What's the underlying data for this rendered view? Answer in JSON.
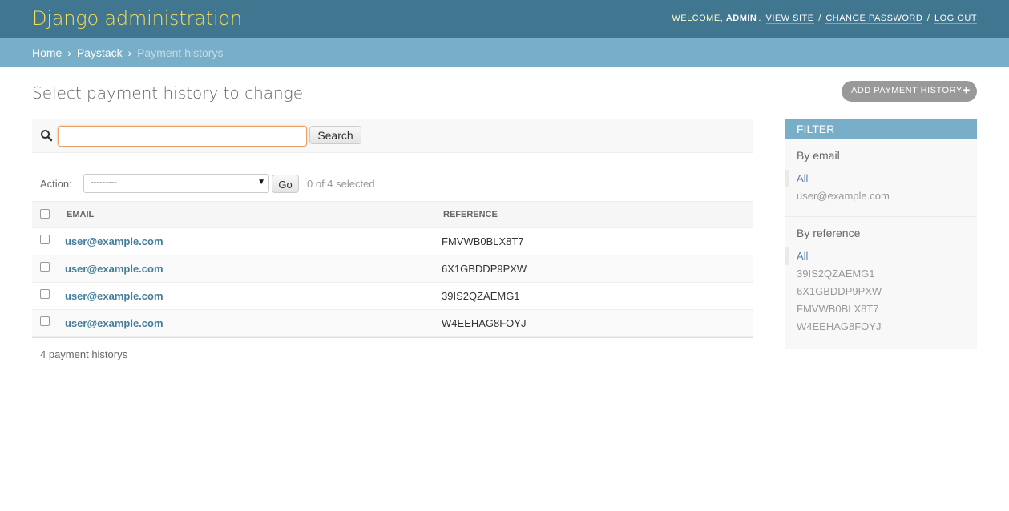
{
  "header": {
    "branding": "Django administration",
    "welcome": "Welcome,",
    "user": "admin",
    "view_site": "View site",
    "change_password": "Change password",
    "log_out": "Log out"
  },
  "breadcrumbs": {
    "home": "Home",
    "app": "Paystack",
    "current": "Payment historys"
  },
  "page_title": "Select payment history to change",
  "add_button": "Add payment history",
  "search": {
    "value": "",
    "button": "Search"
  },
  "actions": {
    "label": "Action:",
    "selected_option": "---------",
    "go": "Go",
    "counter": "0 of 4 selected"
  },
  "table": {
    "headers": [
      "Email",
      "Reference"
    ],
    "rows": [
      {
        "email": "user@example.com",
        "reference": "FMVWB0BLX8T7"
      },
      {
        "email": "user@example.com",
        "reference": "6X1GBDDP9PXW"
      },
      {
        "email": "user@example.com",
        "reference": "39IS2QZAEMG1"
      },
      {
        "email": "user@example.com",
        "reference": "W4EEHAG8FOYJ"
      }
    ]
  },
  "paginator": "4 payment historys",
  "filter": {
    "title": "Filter",
    "sections": [
      {
        "heading": "By email",
        "items": [
          "All",
          "user@example.com"
        ]
      },
      {
        "heading": "By reference",
        "items": [
          "All",
          "39IS2QZAEMG1",
          "6X1GBDDP9PXW",
          "FMVWB0BLX8T7",
          "W4EEHAG8FOYJ"
        ]
      }
    ]
  },
  "colors": {
    "header_bg": "#417690",
    "branding": "#f5dd5d",
    "breadcrumbs_bg": "#79aec8",
    "link": "#447e9b"
  }
}
